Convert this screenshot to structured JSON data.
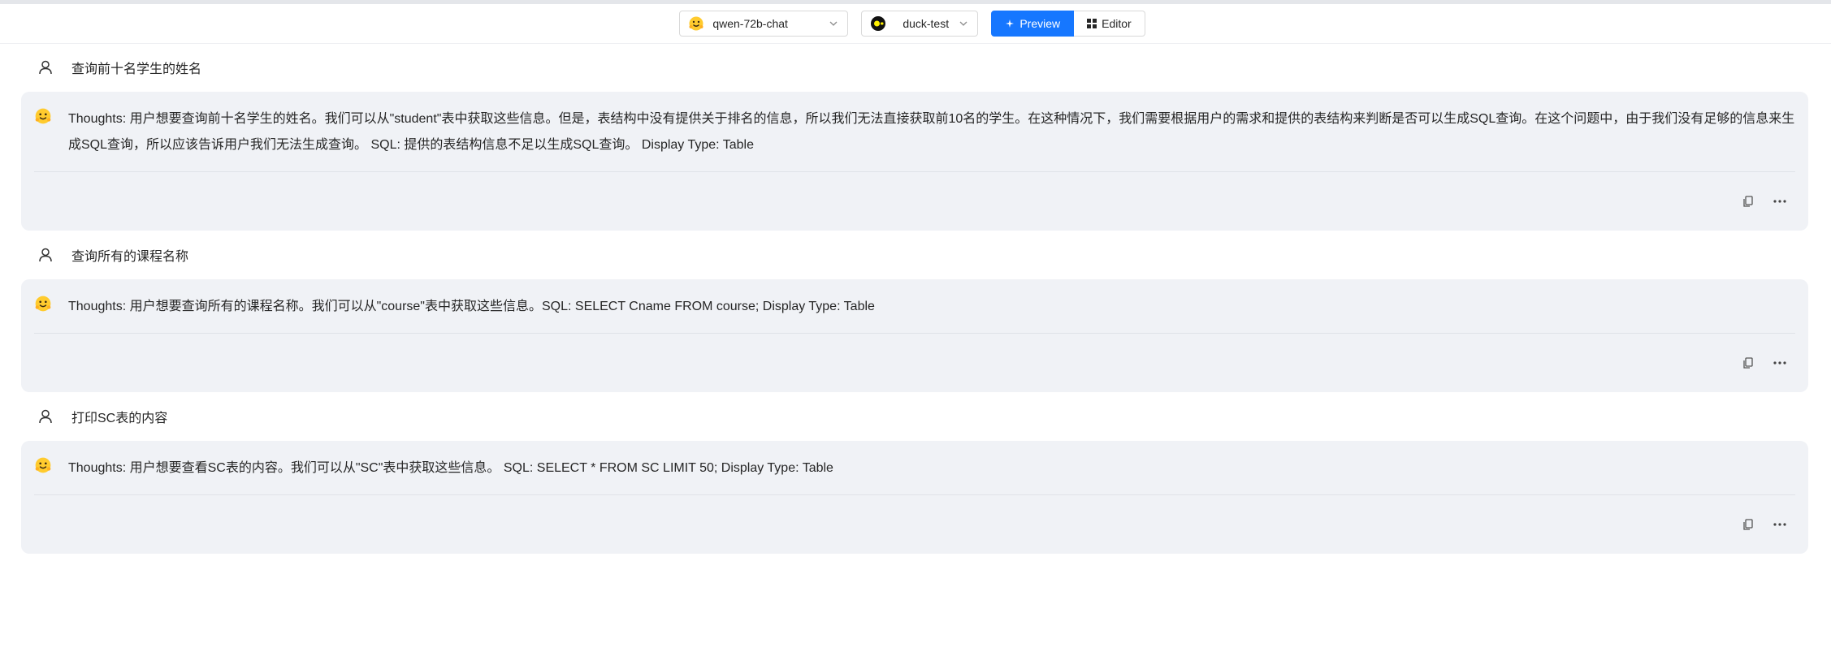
{
  "toolbar": {
    "model": {
      "label": "qwen-72b-chat",
      "icon": "hugging-face-emoji-icon"
    },
    "database": {
      "label": "duck-test",
      "icon": "duckdb-logo-icon"
    },
    "preview_label": "Preview",
    "editor_label": "Editor",
    "accent": "#1677ff"
  },
  "messages": [
    {
      "user": "查询前十名学生的姓名",
      "answer": "Thoughts: 用户想要查询前十名学生的姓名。我们可以从\"student\"表中获取这些信息。但是，表结构中没有提供关于排名的信息，所以我们无法直接获取前10名的学生。在这种情况下，我们需要根据用户的需求和提供的表结构来判断是否可以生成SQL查询。在这个问题中，由于我们没有足够的信息来生成SQL查询，所以应该告诉用户我们无法生成查询。 SQL: 提供的表结构信息不足以生成SQL查询。 Display Type: Table"
    },
    {
      "user": "查询所有的课程名称",
      "answer": "Thoughts: 用户想要查询所有的课程名称。我们可以从\"course\"表中获取这些信息。SQL: SELECT Cname FROM course; Display Type: Table"
    },
    {
      "user": "打印SC表的内容",
      "answer": "Thoughts: 用户想要查看SC表的内容。我们可以从\"SC\"表中获取这些信息。 SQL: SELECT * FROM SC LIMIT 50; Display Type: Table"
    }
  ]
}
